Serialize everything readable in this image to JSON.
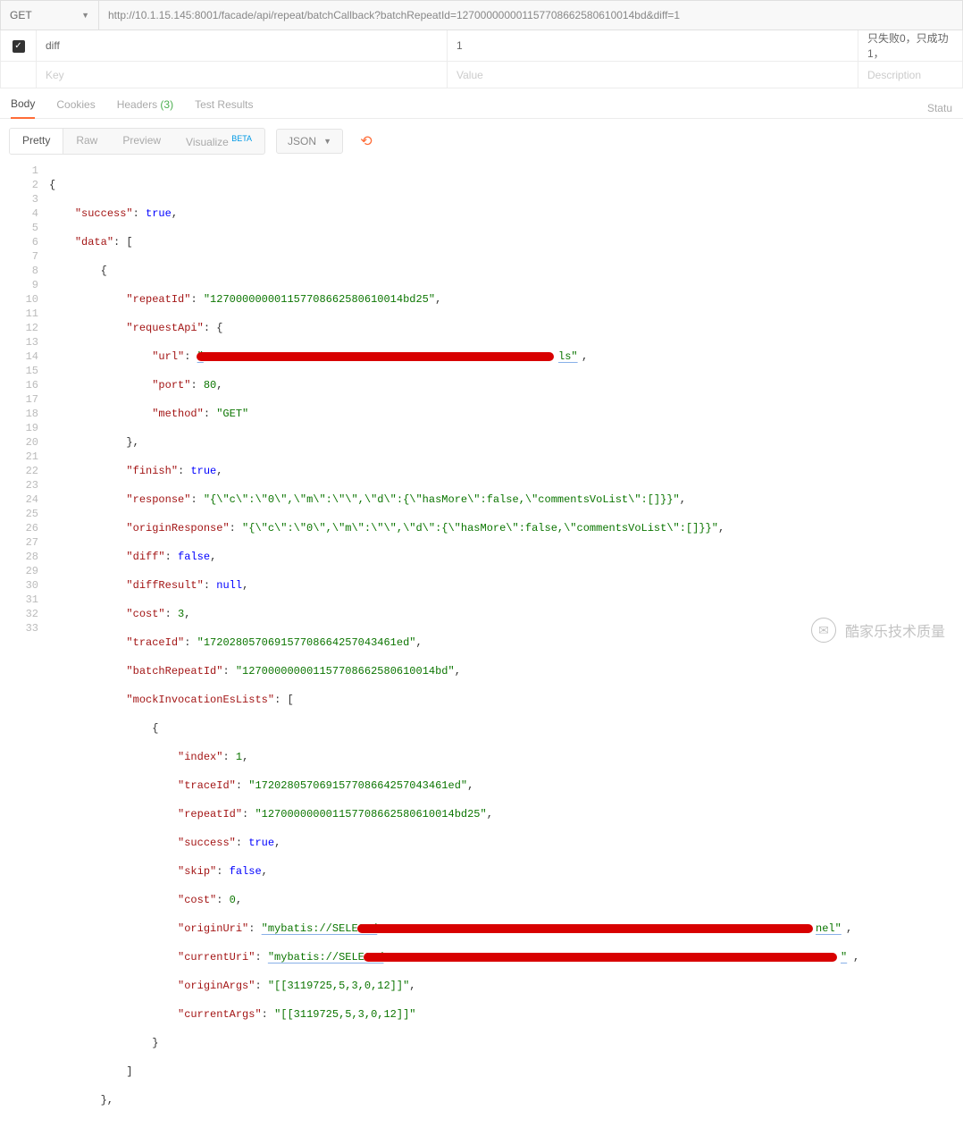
{
  "topbar": {
    "method": "GET",
    "url": "http://10.1.15.145:8001/facade/api/repeat/batchCallback?batchRepeatId=12700000000115770866258061001­4bd&diff=1"
  },
  "params": {
    "rows": [
      {
        "checked": true,
        "key": "diff",
        "value": "1",
        "desc": "只失败0，只成功1，"
      }
    ],
    "placeholders": {
      "key": "Key",
      "value": "Value",
      "desc": "Description"
    }
  },
  "tabs": {
    "body": "Body",
    "cookies": "Cookies",
    "headers": "Headers",
    "headers_count": "(3)",
    "test_results": "Test Results",
    "status_label": "Statu"
  },
  "toolbar": {
    "pretty": "Pretty",
    "raw": "Raw",
    "preview": "Preview",
    "visualize": "Visualize",
    "beta": "BETA",
    "format": "JSON"
  },
  "json": {
    "l01": "{",
    "l02_k": "\"success\"",
    "l02_v": "true",
    "l03_k": "\"data\"",
    "l05_k": "\"repeatId\"",
    "l05_v": "\"127000000001157708662580610014bd25\"",
    "l06_k": "\"requestApi\"",
    "l07_k": "\"url\"",
    "l07_v": "\"",
    "l07_tail": "ls\"",
    "l08_k": "\"port\"",
    "l08_v": "80",
    "l09_k": "\"method\"",
    "l09_v": "\"GET\"",
    "l11_k": "\"finish\"",
    "l11_v": "true",
    "l12_k": "\"response\"",
    "l12_v": "\"{\\\"c\\\":\\\"0\\\",\\\"m\\\":\\\"\\\",\\\"d\\\":{\\\"hasMore\\\":false,\\\"commentsVoList\\\":[]}}\"",
    "l13_k": "\"originResponse\"",
    "l13_v": "\"{\\\"c\\\":\\\"0\\\",\\\"m\\\":\\\"\\\",\\\"d\\\":{\\\"hasMore\\\":false,\\\"commentsVoList\\\":[]}}\"",
    "l14_k": "\"diff\"",
    "l14_v": "false",
    "l15_k": "\"diffResult\"",
    "l15_v": "null",
    "l16_k": "\"cost\"",
    "l16_v": "3",
    "l17_k": "\"traceId\"",
    "l17_v": "\"17202805706915770866425704346­1ed\"",
    "l18_k": "\"batchRepeatId\"",
    "l18_v": "\"127000000001157708662580610014bd\"",
    "l19_k": "\"mockInvocationEsLists\"",
    "l21_k": "\"index\"",
    "l21_v": "1",
    "l22_k": "\"traceId\"",
    "l22_v": "\"172028057069157708664257043461ed\"",
    "l23_k": "\"repeatId\"",
    "l23_v": "\"127000000001157708662580610014bd25\"",
    "l24_k": "\"success\"",
    "l24_v": "true",
    "l25_k": "\"skip\"",
    "l25_v": "false",
    "l26_k": "\"cost\"",
    "l26_v": "0",
    "l27_k": "\"originUri\"",
    "l27_v": "\"mybatis://SELECT/",
    "l27_tail": "nel\"",
    "l28_k": "\"currentUri\"",
    "l28_v": "\"mybatis://SELECT/",
    "l28_tail": "\"",
    "l29_k": "\"originArgs\"",
    "l29_v": "\"[[3119725,5,3,0,12]]\"",
    "l30_k": "\"currentArgs\"",
    "l30_v": "\"[[3119725,5,3,0,12]]\""
  },
  "watermark": {
    "text": "酷家乐技术质量"
  }
}
